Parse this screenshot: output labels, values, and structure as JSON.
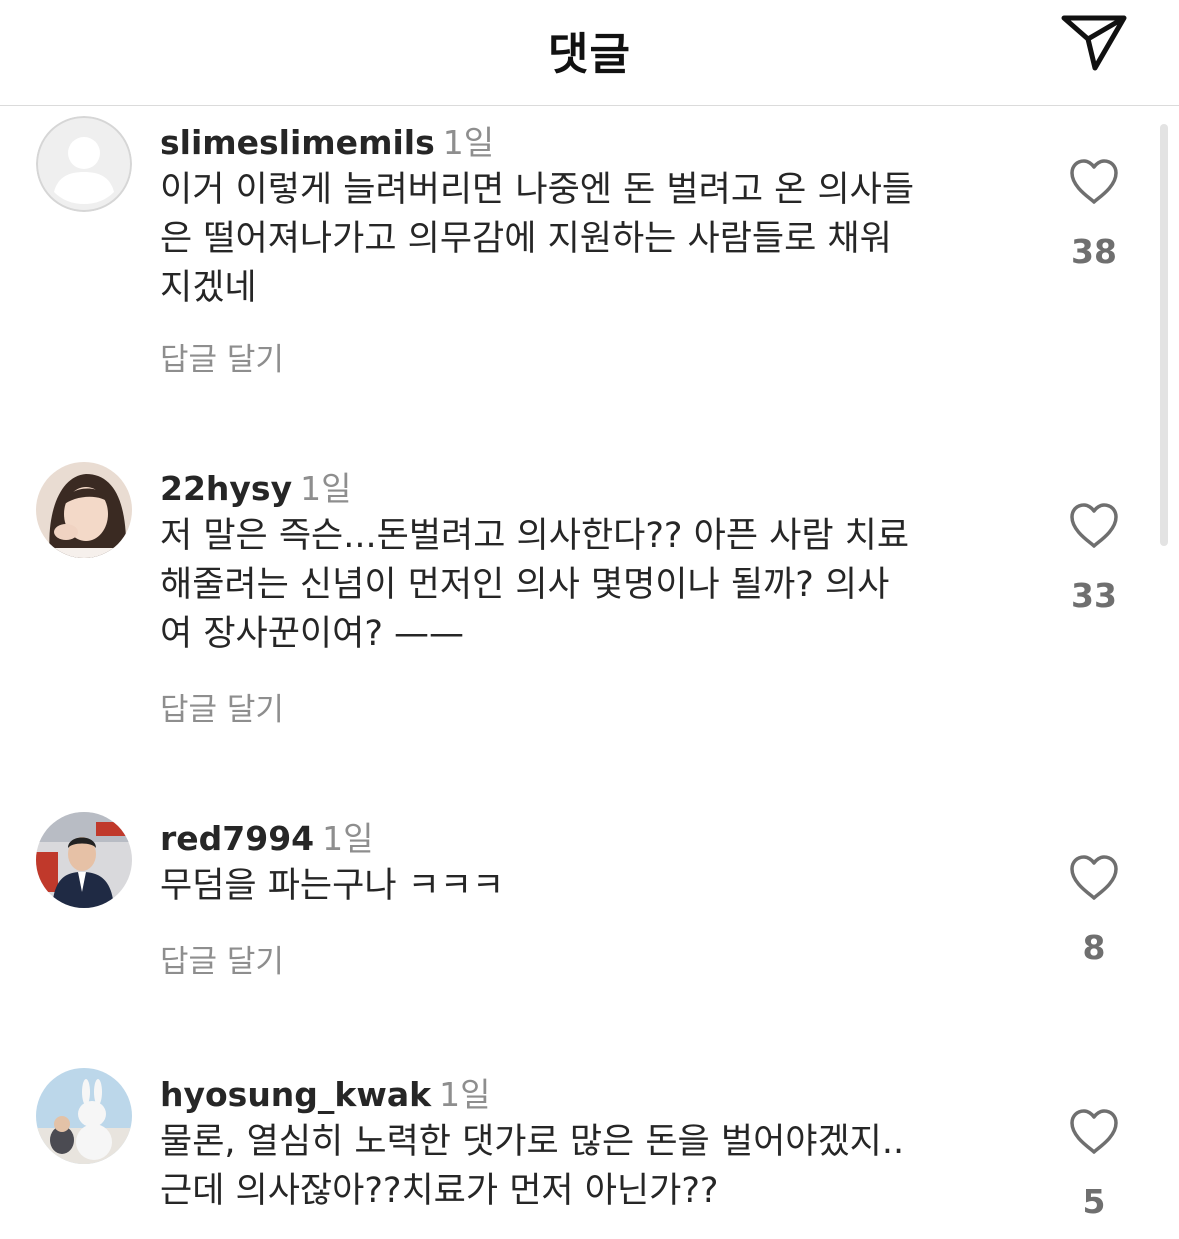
{
  "header": {
    "title": "댓글"
  },
  "comments": [
    {
      "username": "slimeslimemils",
      "time": "1일",
      "lines": [
        "이거 이렇게 늘려버리면 나중엔 돈 벌려고 온 의사들",
        "은 떨어져나가고 의무감에 지원하는 사람들로 채워",
        "지겠네"
      ],
      "reply_label": "답글 달기",
      "likes": "38"
    },
    {
      "username": "22hysy",
      "time": "1일",
      "lines": [
        "저 말은 즉슨...돈벌려고 의사한다?? 아픈 사람 치료",
        "해줄려는 신념이 먼저인 의사 몇명이나 될까? 의사",
        "여 장사꾼이여? ——"
      ],
      "reply_label": "답글 달기",
      "likes": "33"
    },
    {
      "username": "red7994",
      "time": "1일",
      "lines": [
        "무덤을 파는구나 ㅋㅋㅋ"
      ],
      "reply_label": "답글 달기",
      "likes": "8"
    },
    {
      "username": "hyosung_kwak",
      "time": "1일",
      "lines": [
        "물론, 열심히 노력한 댓가로 많은 돈을 벌어야겠지..",
        "근데 의사잖아??치료가 먼저 아닌가??"
      ],
      "reply_label": "",
      "likes": "5"
    }
  ],
  "icons": {
    "send": "send-icon",
    "like": "heart-outline-icon"
  }
}
